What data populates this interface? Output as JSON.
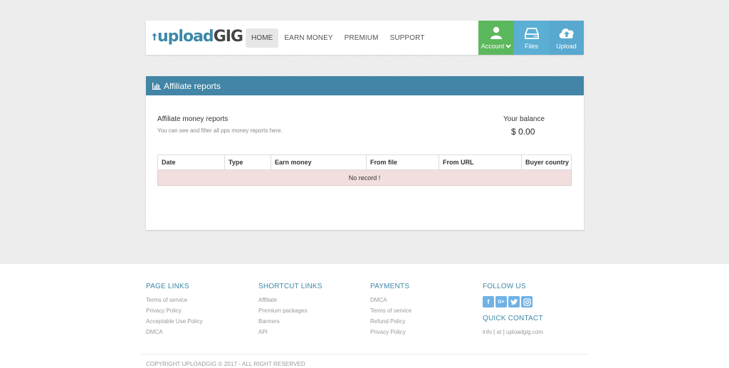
{
  "brand": {
    "logo_a": "upload",
    "logo_b": "GIG"
  },
  "nav": {
    "links": [
      {
        "label": "HOME",
        "active": true
      },
      {
        "label": "EARN MONEY",
        "active": false
      },
      {
        "label": "PREMIUM",
        "active": false
      },
      {
        "label": "SUPPORT",
        "active": false
      }
    ],
    "buttons": [
      {
        "label": "Account",
        "icon": "user-icon",
        "color": "#5cb85c"
      },
      {
        "label": "Files",
        "icon": "hdd-icon",
        "color": "#5bafd5"
      },
      {
        "label": "Upload",
        "icon": "cloud-upload-icon",
        "color": "#58a8cf"
      }
    ]
  },
  "panel": {
    "title": "Affiliate reports",
    "report_title": "Affiliate money reports",
    "report_subtitle": "You can see and filter all pps money reports here.",
    "balance_label": "Your balance",
    "balance_value": "$ 0.00",
    "table": {
      "columns": [
        "Date",
        "Type",
        "Earn money",
        "From file",
        "From URL",
        "Buyer country"
      ],
      "empty_message": "No record !"
    }
  },
  "footer": {
    "page_links": {
      "heading": "PAGE LINKS",
      "items": [
        "Terms of service",
        "Privacy Policy",
        "Acceptable Use Policy",
        "DMCA"
      ]
    },
    "shortcut_links": {
      "heading": "SHORTCUT LINKS",
      "items": [
        "Affiliate",
        "Premium packages",
        "Banners",
        "API"
      ]
    },
    "payments": {
      "heading": "PAYMENTS",
      "items": [
        "DMCA",
        "Terms of service",
        "Refund Policy",
        "Privacy Policy"
      ]
    },
    "follow": {
      "heading": "FOLLOW US",
      "icons": [
        "facebook-icon",
        "google-plus-icon",
        "twitter-icon",
        "instagram-icon"
      ]
    },
    "contact": {
      "heading": "QUICK CONTACT",
      "email": "info [ at ] uploadgig.com"
    },
    "copyright": "COPYRIGHT UPLOADGIG © 2017 - ALL RIGHT RESERVED"
  },
  "colors": {
    "accent": "#4285a6",
    "green": "#5cb85c",
    "blue": "#5bafd5",
    "empty_row": "#f2dede"
  }
}
